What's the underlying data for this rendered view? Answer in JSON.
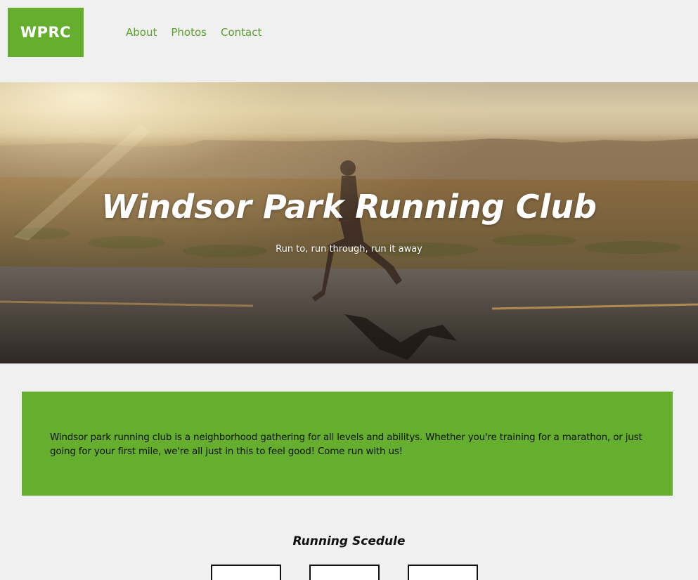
{
  "header": {
    "logo_text": "WPRC",
    "nav": [
      {
        "label": "About"
      },
      {
        "label": "Photos"
      },
      {
        "label": "Contact"
      }
    ]
  },
  "hero": {
    "title": "Windsor Park Running Club",
    "subtitle": "Run to, run through, run it away"
  },
  "intro": {
    "text": "Windsor park running club is a neighborhood gathering for all levels and abilitys. Whether you're training for a marathon, or just going for your first mile, we're all just in this to feel good! Come run with us!"
  },
  "schedule": {
    "title": "Running Scedule"
  },
  "colors": {
    "brand_green": "#66ae2e",
    "nav_link": "#5aa02a",
    "page_background": "#f0f0f0"
  }
}
